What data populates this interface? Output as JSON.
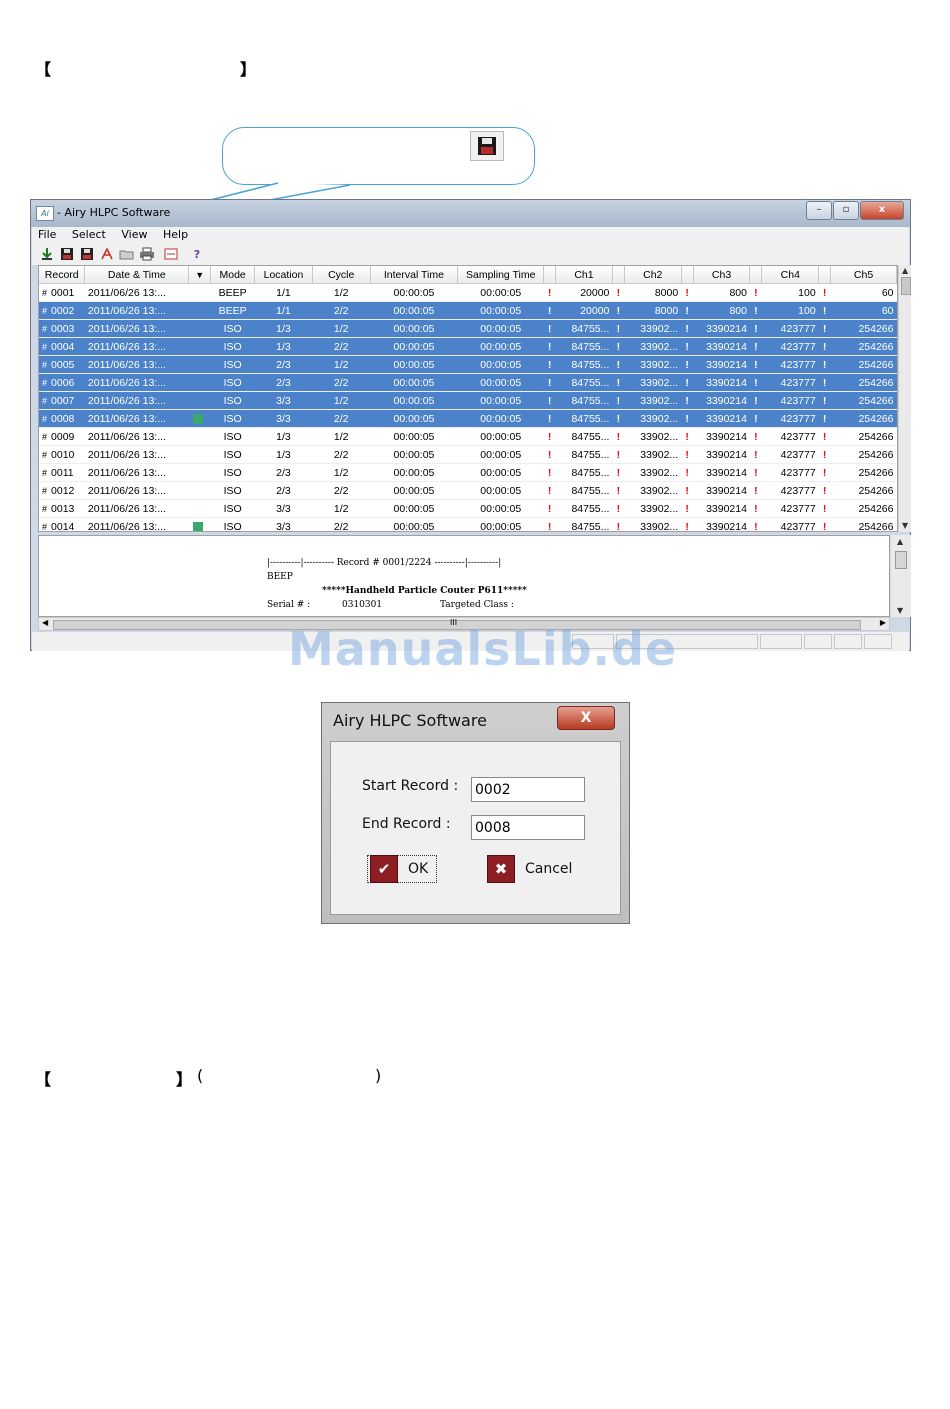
{
  "doc": {
    "bracket_left": "【",
    "bracket_right": "】",
    "paren_left": "(",
    "paren_right": ")"
  },
  "window": {
    "title": "- Airy HLPC Software",
    "controls": {
      "minimize": "–",
      "maximize": "▫",
      "close": "x"
    }
  },
  "menu": [
    "File",
    "Select",
    "View",
    "Help"
  ],
  "toolbar_icons": [
    "download-icon",
    "save-icon",
    "save-selected-icon",
    "pdf-icon",
    "open-folder-icon",
    "print-icon",
    "settings-icon",
    "help-icon"
  ],
  "grid": {
    "columns": [
      "Record",
      "Date & Time",
      "",
      "Mode",
      "Location",
      "Cycle",
      "Interval Time",
      "Sampling Time",
      "",
      "Ch1",
      "",
      "Ch2",
      "",
      "Ch3",
      "",
      "Ch4",
      "",
      "Ch5"
    ],
    "rows": [
      {
        "rec": "0001",
        "dt": "2011/06/26  13:...",
        "mode": "BEEP",
        "loc": "1/1",
        "cyc": "1/2",
        "int": "00:00:05",
        "smp": "00:00:05",
        "ch1": "20000",
        "ch2": "8000",
        "ch3": "800",
        "ch4": "100",
        "ch5": "60",
        "sel": false
      },
      {
        "rec": "0002",
        "dt": "2011/06/26  13:...",
        "mode": "BEEP",
        "loc": "1/1",
        "cyc": "2/2",
        "int": "00:00:05",
        "smp": "00:00:05",
        "ch1": "20000",
        "ch2": "8000",
        "ch3": "800",
        "ch4": "100",
        "ch5": "60",
        "sel": true
      },
      {
        "rec": "0003",
        "dt": "2011/06/26  13:...",
        "mode": "ISO",
        "loc": "1/3",
        "cyc": "1/2",
        "int": "00:00:05",
        "smp": "00:00:05",
        "ch1": "84755...",
        "ch2": "33902...",
        "ch3": "3390214",
        "ch4": "423777",
        "ch5": "254266",
        "sel": true
      },
      {
        "rec": "0004",
        "dt": "2011/06/26  13:...",
        "mode": "ISO",
        "loc": "1/3",
        "cyc": "2/2",
        "int": "00:00:05",
        "smp": "00:00:05",
        "ch1": "84755...",
        "ch2": "33902...",
        "ch3": "3390214",
        "ch4": "423777",
        "ch5": "254266",
        "sel": true
      },
      {
        "rec": "0005",
        "dt": "2011/06/26  13:...",
        "mode": "ISO",
        "loc": "2/3",
        "cyc": "1/2",
        "int": "00:00:05",
        "smp": "00:00:05",
        "ch1": "84755...",
        "ch2": "33902...",
        "ch3": "3390214",
        "ch4": "423777",
        "ch5": "254266",
        "sel": true
      },
      {
        "rec": "0006",
        "dt": "2011/06/26  13:...",
        "mode": "ISO",
        "loc": "2/3",
        "cyc": "2/2",
        "int": "00:00:05",
        "smp": "00:00:05",
        "ch1": "84755...",
        "ch2": "33902...",
        "ch3": "3390214",
        "ch4": "423777",
        "ch5": "254266",
        "sel": true
      },
      {
        "rec": "0007",
        "dt": "2011/06/26  13:...",
        "mode": "ISO",
        "loc": "3/3",
        "cyc": "1/2",
        "int": "00:00:05",
        "smp": "00:00:05",
        "ch1": "84755...",
        "ch2": "33902...",
        "ch3": "3390214",
        "ch4": "423777",
        "ch5": "254266",
        "sel": true
      },
      {
        "rec": "0008",
        "dt": "2011/06/26  13:...",
        "mode": "ISO",
        "loc": "3/3",
        "cyc": "2/2",
        "int": "00:00:05",
        "smp": "00:00:05",
        "ch1": "84755...",
        "ch2": "33902...",
        "ch3": "3390214",
        "ch4": "423777",
        "ch5": "254266",
        "sel": true,
        "icon": true
      },
      {
        "rec": "0009",
        "dt": "2011/06/26  13:...",
        "mode": "ISO",
        "loc": "1/3",
        "cyc": "1/2",
        "int": "00:00:05",
        "smp": "00:00:05",
        "ch1": "84755...",
        "ch2": "33902...",
        "ch3": "3390214",
        "ch4": "423777",
        "ch5": "254266",
        "sel": false
      },
      {
        "rec": "0010",
        "dt": "2011/06/26  13:...",
        "mode": "ISO",
        "loc": "1/3",
        "cyc": "2/2",
        "int": "00:00:05",
        "smp": "00:00:05",
        "ch1": "84755...",
        "ch2": "33902...",
        "ch3": "3390214",
        "ch4": "423777",
        "ch5": "254266",
        "sel": false
      },
      {
        "rec": "0011",
        "dt": "2011/06/26  13:...",
        "mode": "ISO",
        "loc": "2/3",
        "cyc": "1/2",
        "int": "00:00:05",
        "smp": "00:00:05",
        "ch1": "84755...",
        "ch2": "33902...",
        "ch3": "3390214",
        "ch4": "423777",
        "ch5": "254266",
        "sel": false
      },
      {
        "rec": "0012",
        "dt": "2011/06/26  13:...",
        "mode": "ISO",
        "loc": "2/3",
        "cyc": "2/2",
        "int": "00:00:05",
        "smp": "00:00:05",
        "ch1": "84755...",
        "ch2": "33902...",
        "ch3": "3390214",
        "ch4": "423777",
        "ch5": "254266",
        "sel": false
      },
      {
        "rec": "0013",
        "dt": "2011/06/26  13:...",
        "mode": "ISO",
        "loc": "3/3",
        "cyc": "1/2",
        "int": "00:00:05",
        "smp": "00:00:05",
        "ch1": "84755...",
        "ch2": "33902...",
        "ch3": "3390214",
        "ch4": "423777",
        "ch5": "254266",
        "sel": false
      },
      {
        "rec": "0014",
        "dt": "2011/06/26  13:...",
        "mode": "ISO",
        "loc": "3/3",
        "cyc": "2/2",
        "int": "00:00:05",
        "smp": "00:00:05",
        "ch1": "84755...",
        "ch2": "33902...",
        "ch3": "3390214",
        "ch4": "423777",
        "ch5": "254266",
        "sel": false,
        "icon": true
      }
    ]
  },
  "report": {
    "header": "|----------|---------- Record # 0001/2224 ----------|----------|",
    "mode": "BEEP",
    "device": "*****Handheld Particle Couter P611*****",
    "serial_label": "Serial # :",
    "serial_value": "0310301",
    "class_label": "Targeted Class :"
  },
  "scroll_grip": "III",
  "watermark": "ManualsLib.de",
  "dialog": {
    "title": "Airy HLPC Software",
    "close": "X",
    "start_label": "Start Record :",
    "start_value": "0002",
    "end_label": "End Record :",
    "end_value": "0008",
    "ok": "OK",
    "cancel": "Cancel"
  }
}
